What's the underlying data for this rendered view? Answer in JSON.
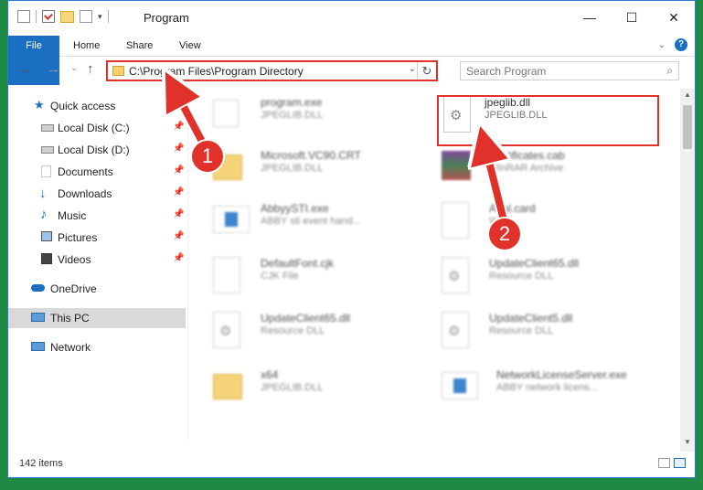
{
  "window": {
    "title": "Program"
  },
  "caption": {
    "minimize": "—",
    "maximize": "☐",
    "close": "✕"
  },
  "ribbon": {
    "tabs": [
      "File",
      "Home",
      "Share",
      "View"
    ],
    "help": "?"
  },
  "nav": {
    "back": "←",
    "forward": "→",
    "recent": "⌄",
    "up": "↑"
  },
  "address": {
    "path": "C:\\Program Files\\Program Directory",
    "dropdown": "⌄",
    "refresh": "↻"
  },
  "search": {
    "placeholder": "Search Program",
    "icon": "⌕"
  },
  "sidebar": {
    "items": [
      {
        "label": "Quick access",
        "icon": "star-icon",
        "pin": ""
      },
      {
        "label": "Local Disk (C:)",
        "icon": "drive-icon",
        "pin": "📌"
      },
      {
        "label": "Local Disk (D:)",
        "icon": "drive-icon",
        "pin": "📌"
      },
      {
        "label": "Documents",
        "icon": "documents-icon",
        "pin": "📌"
      },
      {
        "label": "Downloads",
        "icon": "download-icon",
        "pin": "📌"
      },
      {
        "label": "Music",
        "icon": "music-icon",
        "pin": "📌"
      },
      {
        "label": "Pictures",
        "icon": "pictures-icon",
        "pin": "📌"
      },
      {
        "label": "Videos",
        "icon": "videos-icon",
        "pin": "📌"
      },
      {
        "label": "OneDrive",
        "icon": "cloud-icon",
        "pin": ""
      },
      {
        "label": "This PC",
        "icon": "computer-icon",
        "pin": ""
      },
      {
        "label": "Network",
        "icon": "network-icon",
        "pin": ""
      }
    ]
  },
  "files": [
    {
      "name": "program.exe",
      "type": "JPEGLIB.DLL",
      "icon": "exe-icon"
    },
    {
      "name": "jpeglib.dll",
      "type": "JPEGLIB.DLL",
      "icon": "dll-icon"
    },
    {
      "name": "Microsoft.VC90.CRT",
      "type": "JPEGLIB.DLL",
      "icon": "folder-icon"
    },
    {
      "name": "Certificates.cab",
      "type": "WinRAR Archive",
      "icon": "archive-icon"
    },
    {
      "name": "AbbyySTI.exe",
      "type": "ABBY sti event hand...",
      "icon": "exe-icon"
    },
    {
      "name": "Arial.card",
      "type": "W...",
      "icon": "document-icon"
    },
    {
      "name": "DefaultFont.cjk",
      "type": "CJK File",
      "icon": "document-icon"
    },
    {
      "name": "UpdateClient65.dll",
      "type": "Resource DLL",
      "icon": "dll-icon"
    },
    {
      "name": "UpdateClient65.dll",
      "type": "Resource DLL",
      "icon": "dll-icon"
    },
    {
      "name": "UpdateClient5.dll",
      "type": "Resource DLL",
      "icon": "dll-icon"
    },
    {
      "name": "x64",
      "type": "JPEGLIB.DLL",
      "icon": "folder-icon"
    },
    {
      "name": "NetworkLicenseServer.exe",
      "type": "ABBY network licens...",
      "icon": "exe-icon"
    }
  ],
  "callouts": [
    "1",
    "2"
  ],
  "status": {
    "count": "142 items"
  },
  "colors": {
    "accent": "#1b6fc2",
    "highlight": "#e0322b",
    "desktop": "#1e8a43"
  }
}
